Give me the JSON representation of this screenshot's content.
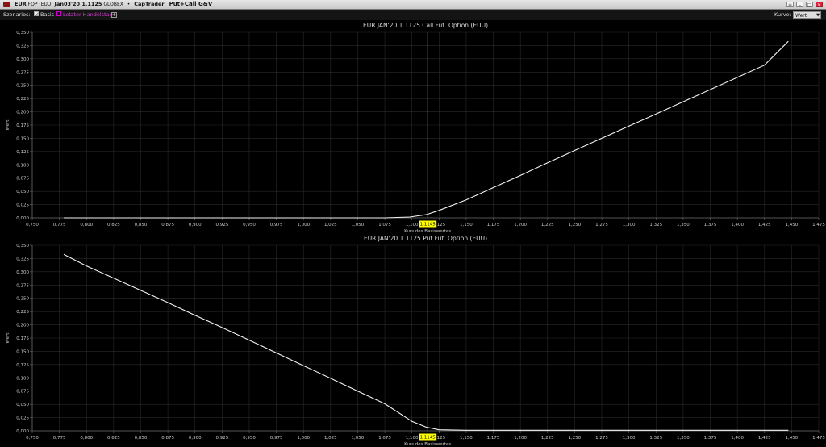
{
  "window": {
    "symbol": "EUR",
    "exchange_small": "FOP (EUU)",
    "contract": "Jan03'20 1.1125",
    "venue": "GLOBEX",
    "bullet": "•",
    "broker": "CapTrader",
    "title": "Put+Call G&V"
  },
  "toolbar": {
    "szenarios_label": "Szenarios:",
    "basis_label": "Basis",
    "letzter_label": "Letzter Handelstag",
    "add_symbol": "+",
    "kurve_label": "Kurve:",
    "kurve_value": "Wert"
  },
  "colors": {
    "background": "#000000",
    "line": "#f2f2f2",
    "grid": "#2a2a2a",
    "axis": "#6a6a6a",
    "marker_bg": "#ffff00",
    "marker_line": "#9a9a9a"
  },
  "chart_data": [
    {
      "type": "line",
      "title": "EUR JAN'20 1.1125 Call Fut. Option (EUU)",
      "xlabel": "Kurs des Basiswertes",
      "ylabel": "Wert",
      "xlim": [
        0.75,
        1.475
      ],
      "ylim": [
        0,
        0.35
      ],
      "x_ticks": [
        "0,750",
        "0,775",
        "0,800",
        "0,825",
        "0,850",
        "0,875",
        "0,900",
        "0,925",
        "0,950",
        "0,975",
        "1,000",
        "1,025",
        "1,050",
        "1,075",
        "1,100",
        "1,125",
        "1,150",
        "1,175",
        "1,200",
        "1,225",
        "1,250",
        "1,275",
        "1,300",
        "1,325",
        "1,350",
        "1,375",
        "1,400",
        "1,425",
        "1,450",
        "1,475"
      ],
      "y_ticks": [
        "0,000",
        "0,025",
        "0,050",
        "0,075",
        "0,100",
        "0,125",
        "0,150",
        "0,175",
        "0,200",
        "0,225",
        "0,250",
        "0,275",
        "0,300",
        "0,325",
        "0,350"
      ],
      "grid": true,
      "marker": {
        "x": 1.1145,
        "label": "1,1145"
      },
      "series": [
        {
          "x": [
            0.779,
            1.075,
            1.098,
            1.113,
            1.125,
            1.15,
            1.175,
            1.2,
            1.225,
            1.25,
            1.275,
            1.3,
            1.325,
            1.35,
            1.375,
            1.4,
            1.425,
            1.447
          ],
          "y": [
            0.0,
            0.0,
            0.0015,
            0.006,
            0.014,
            0.034,
            0.057,
            0.08,
            0.104,
            0.127,
            0.15,
            0.173,
            0.196,
            0.219,
            0.242,
            0.265,
            0.288,
            0.333
          ]
        }
      ]
    },
    {
      "type": "line",
      "title": "EUR JAN'20 1.1125 Put Fut. Option (EUU)",
      "xlabel": "Kurs des Basiswertes",
      "ylabel": "Wert",
      "xlim": [
        0.75,
        1.475
      ],
      "ylim": [
        0,
        0.35
      ],
      "x_ticks": [
        "0,750",
        "0,775",
        "0,800",
        "0,825",
        "0,850",
        "0,875",
        "0,900",
        "0,925",
        "0,950",
        "0,975",
        "1,000",
        "1,025",
        "1,050",
        "1,075",
        "1,100",
        "1,125",
        "1,150",
        "1,175",
        "1,200",
        "1,225",
        "1,250",
        "1,275",
        "1,300",
        "1,325",
        "1,350",
        "1,375",
        "1,400",
        "1,425",
        "1,450",
        "1,475"
      ],
      "y_ticks": [
        "0,000",
        "0,025",
        "0,050",
        "0,075",
        "0,100",
        "0,125",
        "0,150",
        "0,175",
        "0,200",
        "0,225",
        "0,250",
        "0,275",
        "0,300",
        "0,325",
        "0,350"
      ],
      "grid": true,
      "marker": {
        "x": 1.1145,
        "label": "1,1145"
      },
      "series": [
        {
          "x": [
            0.779,
            0.8,
            0.825,
            0.85,
            0.875,
            0.9,
            0.925,
            0.95,
            0.975,
            1.0,
            1.025,
            1.05,
            1.075,
            1.1,
            1.113,
            1.125,
            1.15,
            1.2,
            1.3,
            1.447
          ],
          "y": [
            0.333,
            0.311,
            0.288,
            0.265,
            0.242,
            0.218,
            0.195,
            0.171,
            0.147,
            0.123,
            0.099,
            0.075,
            0.051,
            0.018,
            0.007,
            0.002,
            0.001,
            0.001,
            0.001,
            0.001
          ]
        }
      ]
    }
  ]
}
